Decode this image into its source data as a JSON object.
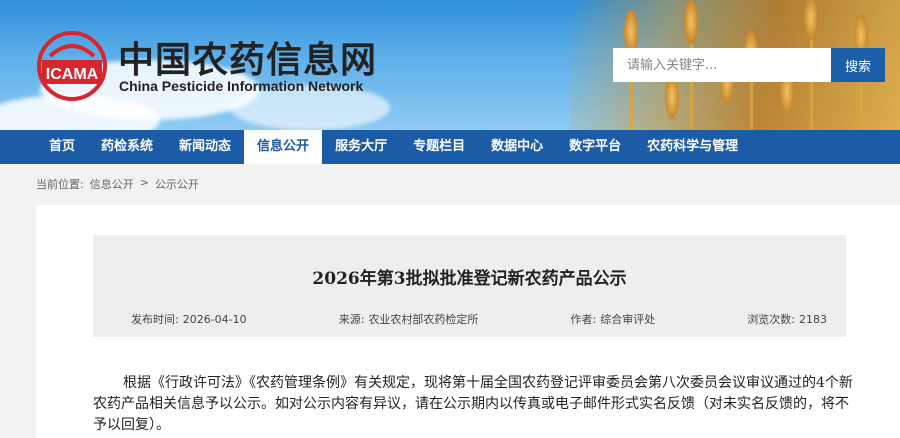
{
  "header": {
    "logo_text": "ICAMA",
    "title_cn": "中国农药信息网",
    "title_en": "China Pesticide Information Network"
  },
  "search": {
    "placeholder": "请输入关键字...",
    "button_label": "搜索"
  },
  "nav": {
    "items": [
      {
        "label": "首页",
        "active": false
      },
      {
        "label": "药检系统",
        "active": false
      },
      {
        "label": "新闻动态",
        "active": false
      },
      {
        "label": "信息公开",
        "active": true
      },
      {
        "label": "服务大厅",
        "active": false
      },
      {
        "label": "专题栏目",
        "active": false
      },
      {
        "label": "数据中心",
        "active": false
      },
      {
        "label": "数字平台",
        "active": false
      },
      {
        "label": "农药科学与管理",
        "active": false
      }
    ]
  },
  "breadcrumb": {
    "prefix": "当前位置:",
    "items": [
      "信息公开",
      "公示公开"
    ],
    "separator": ">"
  },
  "article": {
    "title": "2026年第3批拟批准登记新农药产品公示",
    "meta": {
      "date_label": "发布时间:",
      "date": "2026-04-10",
      "source_label": "来源:",
      "source": "农业农村部农药检定所",
      "author_label": "作者:",
      "author": "综合审评处",
      "views_label": "浏览次数:",
      "views": "2183"
    },
    "body": "根据《行政许可法》《农药管理条例》有关规定，现将第十届全国农药登记评审委员会第八次委员会议审议通过的4个新农药产品相关信息予以公示。如对公示内容有异议，请在公示期内以传真或电子邮件形式实名反馈（对未实名反馈的，将不予以回复）。"
  },
  "colors": {
    "nav_bg": "#1c5ba6",
    "search_button": "#1b5fa8",
    "logo_red": "#d8262e"
  }
}
